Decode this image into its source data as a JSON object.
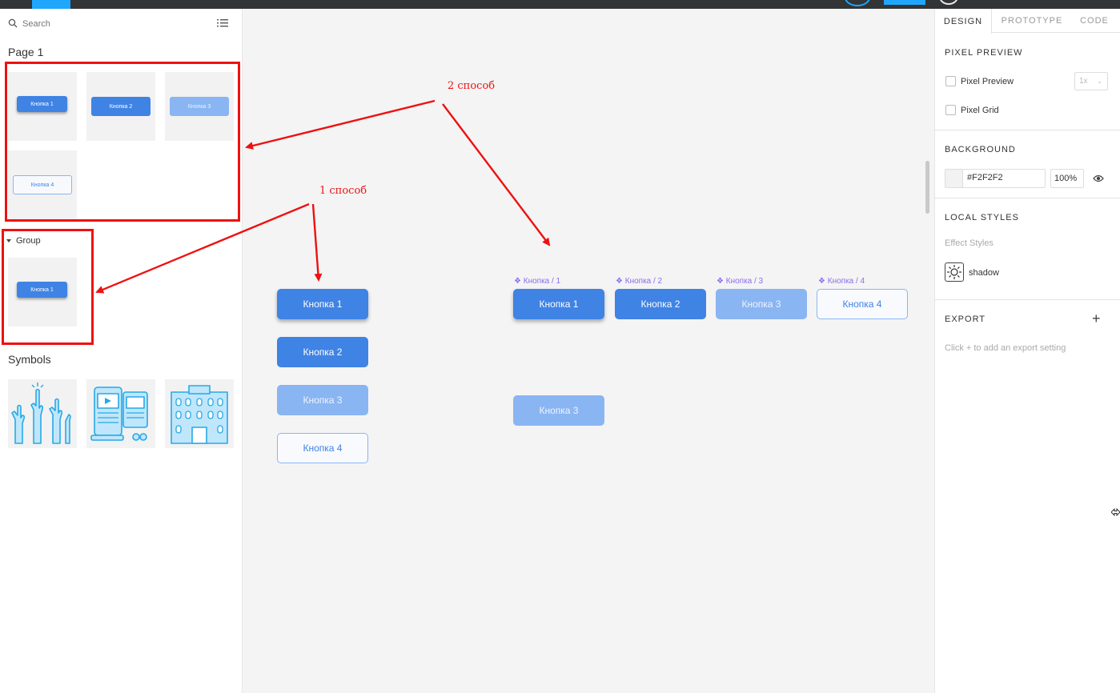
{
  "left_panel": {
    "search_placeholder": "Search",
    "page_title": "Page 1",
    "page_thumbs": [
      "Кнопка 1",
      "Кнопка 2",
      "Кнопка 3",
      "Кнопка 4"
    ],
    "group_label": "Group",
    "group_thumb": "Кнопка 1",
    "symbols_title": "Symbols",
    "symbol_icons": [
      "hands-raised-icon",
      "tablet-media-icon",
      "building-icon"
    ]
  },
  "canvas": {
    "column_buttons": [
      "Кнопка 1",
      "Кнопка 2",
      "Кнопка 3",
      "Кнопка 4"
    ],
    "row_labels": [
      "❖ Кнопка / 1",
      "❖ Кнопка / 2",
      "❖ Кнопка / 3",
      "❖ Кнопка / 4"
    ],
    "row_buttons": [
      "Кнопка 1",
      "Кнопка 2",
      "Кнопка 3",
      "Кнопка 4"
    ],
    "single_button": "Кнопка 3",
    "annotations": {
      "method_2": "2 способ",
      "method_1": "1 способ"
    },
    "annotation_color": "#ee1111"
  },
  "right_panel": {
    "tabs": [
      "DESIGN",
      "PROTOTYPE",
      "CODE"
    ],
    "pixel_preview": {
      "heading": "PIXEL PREVIEW",
      "pixel_preview_label": "Pixel Preview",
      "pixel_grid_label": "Pixel Grid",
      "zoom": "1x"
    },
    "background": {
      "heading": "BACKGROUND",
      "hex": "#F2F2F2",
      "opacity": "100%"
    },
    "local_styles": {
      "heading": "LOCAL STYLES",
      "subheading": "Effect Styles",
      "style_name": "shadow"
    },
    "export": {
      "heading": "EXPORT",
      "hint": "Click + to add an export setting"
    }
  },
  "colors": {
    "primary": "#3f83e4",
    "primary_light": "#8ab5f3",
    "accent": "#1ea7fd",
    "component_label": "#8a6de8"
  }
}
